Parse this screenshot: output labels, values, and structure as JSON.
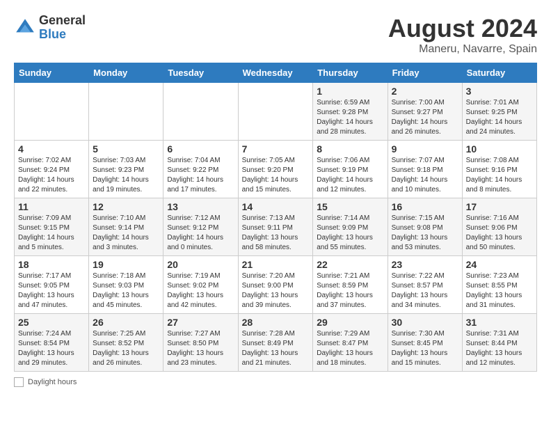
{
  "header": {
    "logo": {
      "general": "General",
      "blue": "Blue"
    },
    "title": "August 2024",
    "location": "Maneru, Navarre, Spain"
  },
  "weekdays": [
    "Sunday",
    "Monday",
    "Tuesday",
    "Wednesday",
    "Thursday",
    "Friday",
    "Saturday"
  ],
  "weeks": [
    [
      {
        "day": "",
        "sunrise": "",
        "sunset": "",
        "daylight": ""
      },
      {
        "day": "",
        "sunrise": "",
        "sunset": "",
        "daylight": ""
      },
      {
        "day": "",
        "sunrise": "",
        "sunset": "",
        "daylight": ""
      },
      {
        "day": "",
        "sunrise": "",
        "sunset": "",
        "daylight": ""
      },
      {
        "day": "1",
        "sunrise": "6:59 AM",
        "sunset": "9:28 PM",
        "daylight": "14 hours and 28 minutes."
      },
      {
        "day": "2",
        "sunrise": "7:00 AM",
        "sunset": "9:27 PM",
        "daylight": "14 hours and 26 minutes."
      },
      {
        "day": "3",
        "sunrise": "7:01 AM",
        "sunset": "9:25 PM",
        "daylight": "14 hours and 24 minutes."
      }
    ],
    [
      {
        "day": "4",
        "sunrise": "7:02 AM",
        "sunset": "9:24 PM",
        "daylight": "14 hours and 22 minutes."
      },
      {
        "day": "5",
        "sunrise": "7:03 AM",
        "sunset": "9:23 PM",
        "daylight": "14 hours and 19 minutes."
      },
      {
        "day": "6",
        "sunrise": "7:04 AM",
        "sunset": "9:22 PM",
        "daylight": "14 hours and 17 minutes."
      },
      {
        "day": "7",
        "sunrise": "7:05 AM",
        "sunset": "9:20 PM",
        "daylight": "14 hours and 15 minutes."
      },
      {
        "day": "8",
        "sunrise": "7:06 AM",
        "sunset": "9:19 PM",
        "daylight": "14 hours and 12 minutes."
      },
      {
        "day": "9",
        "sunrise": "7:07 AM",
        "sunset": "9:18 PM",
        "daylight": "14 hours and 10 minutes."
      },
      {
        "day": "10",
        "sunrise": "7:08 AM",
        "sunset": "9:16 PM",
        "daylight": "14 hours and 8 minutes."
      }
    ],
    [
      {
        "day": "11",
        "sunrise": "7:09 AM",
        "sunset": "9:15 PM",
        "daylight": "14 hours and 5 minutes."
      },
      {
        "day": "12",
        "sunrise": "7:10 AM",
        "sunset": "9:14 PM",
        "daylight": "14 hours and 3 minutes."
      },
      {
        "day": "13",
        "sunrise": "7:12 AM",
        "sunset": "9:12 PM",
        "daylight": "14 hours and 0 minutes."
      },
      {
        "day": "14",
        "sunrise": "7:13 AM",
        "sunset": "9:11 PM",
        "daylight": "13 hours and 58 minutes."
      },
      {
        "day": "15",
        "sunrise": "7:14 AM",
        "sunset": "9:09 PM",
        "daylight": "13 hours and 55 minutes."
      },
      {
        "day": "16",
        "sunrise": "7:15 AM",
        "sunset": "9:08 PM",
        "daylight": "13 hours and 53 minutes."
      },
      {
        "day": "17",
        "sunrise": "7:16 AM",
        "sunset": "9:06 PM",
        "daylight": "13 hours and 50 minutes."
      }
    ],
    [
      {
        "day": "18",
        "sunrise": "7:17 AM",
        "sunset": "9:05 PM",
        "daylight": "13 hours and 47 minutes."
      },
      {
        "day": "19",
        "sunrise": "7:18 AM",
        "sunset": "9:03 PM",
        "daylight": "13 hours and 45 minutes."
      },
      {
        "day": "20",
        "sunrise": "7:19 AM",
        "sunset": "9:02 PM",
        "daylight": "13 hours and 42 minutes."
      },
      {
        "day": "21",
        "sunrise": "7:20 AM",
        "sunset": "9:00 PM",
        "daylight": "13 hours and 39 minutes."
      },
      {
        "day": "22",
        "sunrise": "7:21 AM",
        "sunset": "8:59 PM",
        "daylight": "13 hours and 37 minutes."
      },
      {
        "day": "23",
        "sunrise": "7:22 AM",
        "sunset": "8:57 PM",
        "daylight": "13 hours and 34 minutes."
      },
      {
        "day": "24",
        "sunrise": "7:23 AM",
        "sunset": "8:55 PM",
        "daylight": "13 hours and 31 minutes."
      }
    ],
    [
      {
        "day": "25",
        "sunrise": "7:24 AM",
        "sunset": "8:54 PM",
        "daylight": "13 hours and 29 minutes."
      },
      {
        "day": "26",
        "sunrise": "7:25 AM",
        "sunset": "8:52 PM",
        "daylight": "13 hours and 26 minutes."
      },
      {
        "day": "27",
        "sunrise": "7:27 AM",
        "sunset": "8:50 PM",
        "daylight": "13 hours and 23 minutes."
      },
      {
        "day": "28",
        "sunrise": "7:28 AM",
        "sunset": "8:49 PM",
        "daylight": "13 hours and 21 minutes."
      },
      {
        "day": "29",
        "sunrise": "7:29 AM",
        "sunset": "8:47 PM",
        "daylight": "13 hours and 18 minutes."
      },
      {
        "day": "30",
        "sunrise": "7:30 AM",
        "sunset": "8:45 PM",
        "daylight": "13 hours and 15 minutes."
      },
      {
        "day": "31",
        "sunrise": "7:31 AM",
        "sunset": "8:44 PM",
        "daylight": "13 hours and 12 minutes."
      }
    ]
  ],
  "legend": {
    "label": "Daylight hours"
  }
}
